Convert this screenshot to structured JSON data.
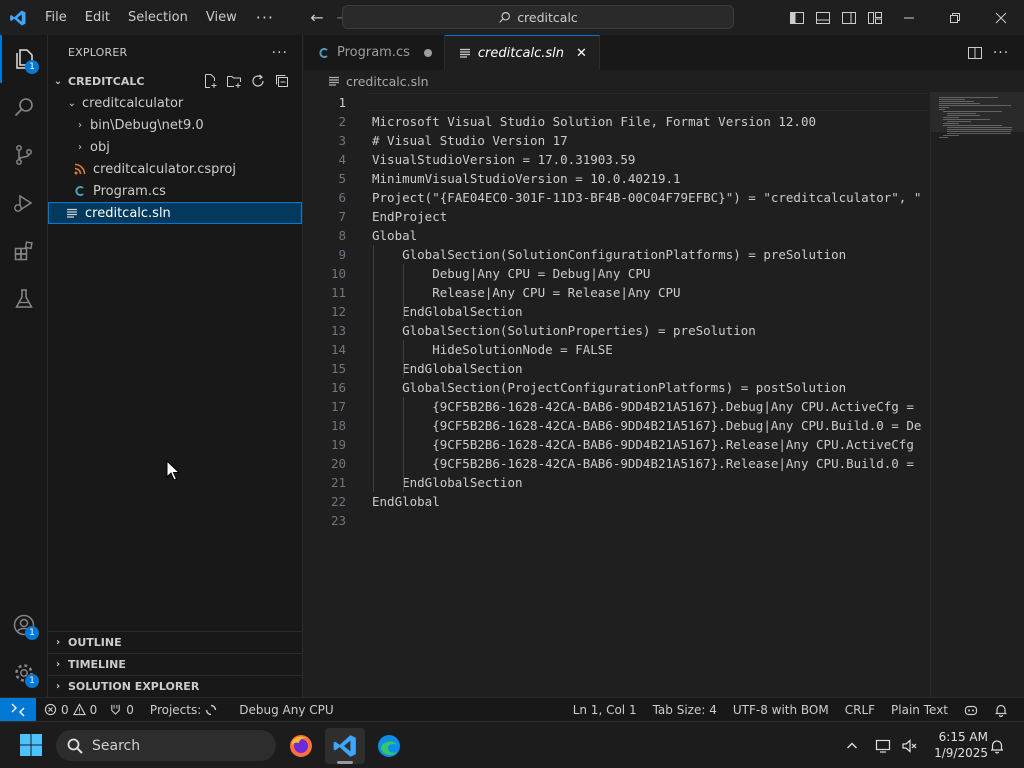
{
  "titlebar": {
    "menus": [
      "File",
      "Edit",
      "Selection",
      "View"
    ],
    "more": "···",
    "command_center": "creditcalc"
  },
  "activity": {
    "explorer_badge": "1",
    "accounts_badge": "1",
    "manage_badge": "1"
  },
  "explorer": {
    "header": "EXPLORER",
    "more": "···",
    "workspace": "CREDITCALC",
    "tree": [
      {
        "label": "creditcalculator",
        "kind": "folder-open"
      },
      {
        "label": "bin\\Debug\\net9.0",
        "kind": "folder"
      },
      {
        "label": "obj",
        "kind": "folder"
      },
      {
        "label": "creditcalculator.csproj",
        "kind": "rss"
      },
      {
        "label": "Program.cs",
        "kind": "csharp"
      },
      {
        "label": "creditcalc.sln",
        "kind": "lines"
      }
    ],
    "sections": [
      "OUTLINE",
      "TIMELINE",
      "SOLUTION EXPLORER"
    ]
  },
  "tabs": [
    {
      "label": "Program.cs",
      "modified": true
    },
    {
      "label": "creditcalc.sln",
      "active": true,
      "close": "✕"
    }
  ],
  "breadcrumb": "creditcalc.sln",
  "code": {
    "current_line": 1,
    "lines": [
      "",
      "Microsoft Visual Studio Solution File, Format Version 12.00",
      "# Visual Studio Version 17",
      "VisualStudioVersion = 17.0.31903.59",
      "MinimumVisualStudioVersion = 10.0.40219.1",
      "Project(\"{FAE04EC0-301F-11D3-BF4B-00C04F79EFBC}\") = \"creditcalculator\", \"",
      "EndProject",
      "Global",
      "    GlobalSection(SolutionConfigurationPlatforms) = preSolution",
      "        Debug|Any CPU = Debug|Any CPU",
      "        Release|Any CPU = Release|Any CPU",
      "    EndGlobalSection",
      "    GlobalSection(SolutionProperties) = preSolution",
      "        HideSolutionNode = FALSE",
      "    EndGlobalSection",
      "    GlobalSection(ProjectConfigurationPlatforms) = postSolution",
      "        {9CF5B2B6-1628-42CA-BAB6-9DD4B21A5167}.Debug|Any CPU.ActiveCfg = ",
      "        {9CF5B2B6-1628-42CA-BAB6-9DD4B21A5167}.Debug|Any CPU.Build.0 = De",
      "        {9CF5B2B6-1628-42CA-BAB6-9DD4B21A5167}.Release|Any CPU.ActiveCfg",
      "        {9CF5B2B6-1628-42CA-BAB6-9DD4B21A5167}.Release|Any CPU.Build.0 =",
      "    EndGlobalSection",
      "EndGlobal",
      ""
    ]
  },
  "statusbar": {
    "errors": "0",
    "warnings": "0",
    "ports": "0",
    "projects": "Projects:",
    "config": "Debug Any CPU",
    "position": "Ln 1, Col 1",
    "tab_size": "Tab Size: 4",
    "encoding": "UTF-8 with BOM",
    "eol": "CRLF",
    "language": "Plain Text"
  },
  "taskbar": {
    "search": "Search",
    "time": "6:15 AM",
    "date": "1/9/2025"
  },
  "colors": {
    "accent": "#0078d4",
    "editor_bg": "#1f1f1f",
    "sidebar_bg": "#181818",
    "selection": "#04395e"
  }
}
